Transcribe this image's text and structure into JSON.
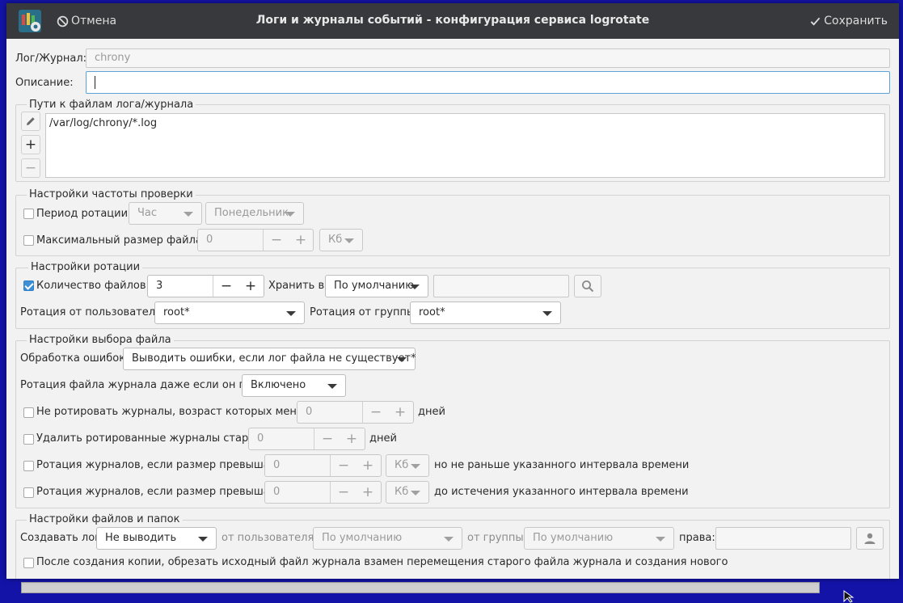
{
  "header": {
    "cancel_label": "Отмена",
    "title": "Логи и журналы событий - конфигурация сервиса logrotate",
    "save_label": "Сохранить"
  },
  "log": {
    "label": "Лог/Журнал:",
    "value": "chrony",
    "desc_label": "Описание:",
    "desc_value": ""
  },
  "paths": {
    "title": "Пути к файлам лога/журнала",
    "items": [
      "/var/log/chrony/*.log"
    ]
  },
  "frequency": {
    "title": "Настройки частоты проверки",
    "period_label": "Период ротации:",
    "period_unit": "Час",
    "period_day": "Понедельник",
    "maxsize_label": "Максимальный размер файла:",
    "maxsize_value": "0",
    "maxsize_unit": "Кб"
  },
  "rotation": {
    "title": "Настройки ротации",
    "count_label": "Количество файлов:",
    "count_value": "3",
    "store_label": "Хранить в:",
    "store_value": "По умолчанию",
    "store_path": "",
    "user_label": "Ротация от пользователя:",
    "user_value": "root*",
    "group_label": "Ротация от группы:",
    "group_value": "root*"
  },
  "selection": {
    "title": "Настройки выбора файла",
    "errors_label": "Обработка ошибок:",
    "errors_value": "Выводить ошибки, если лог файла не существует*",
    "empty_label": "Ротация файла журнала даже если он пуст:",
    "empty_value": "Включено",
    "minage_label": "Не ротировать журналы, возраст которых меньше",
    "minage_value": "0",
    "minage_unit": "дней",
    "maxage_label": "Удалить ротированные журналы старше",
    "maxage_value": "0",
    "maxage_unit": "дней",
    "minsize_label": "Ротация журналов, если размер превышает",
    "minsize_value": "0",
    "minsize_unit": "Кб",
    "minsize_suffix": "но не раньше указанного интервала времени",
    "maxsize_label": "Ротация журналов, если размер превышает",
    "maxsize_value": "0",
    "maxsize_unit": "Кб",
    "maxsize_suffix": "до истечения указанного интервала времени"
  },
  "files": {
    "title": "Настройки файлов и папок",
    "create_label": "Создавать лог",
    "create_value": "Не выводить",
    "user_label": "от пользователя:",
    "user_value": "По умолчанию",
    "group_label": "от группы:",
    "group_value": "По умолчанию",
    "perms_label": "права:",
    "perms_value": "",
    "copytruncate_label": "После создания копии, обрезать исходный файл журнала взамен перемещения старого файла журнала и создания нового"
  },
  "colors": {
    "header_bg": "#38393c",
    "accent": "#3d8fd6",
    "desktop_bg": "#1313a8"
  }
}
